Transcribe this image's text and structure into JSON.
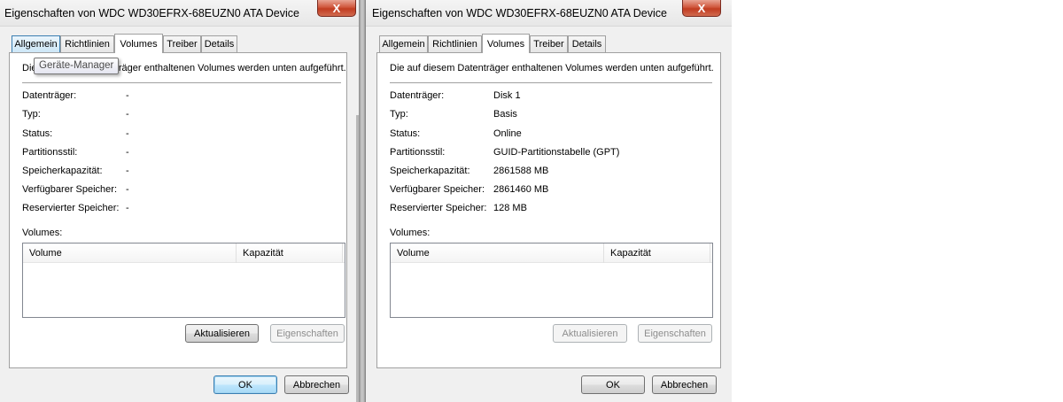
{
  "left": {
    "title": "Eigenschaften von WDC WD30EFRX-68EUZN0 ATA Device",
    "close_glyph": "X",
    "tabs": [
      {
        "label": "Allgemein"
      },
      {
        "label": "Richtlinien"
      },
      {
        "label": "Volumes"
      },
      {
        "label": "Treiber"
      },
      {
        "label": "Details"
      }
    ],
    "active_tab": "Volumes",
    "tooltip": "Geräte-Manager",
    "description": "Die auf diesem Datenträger enthaltenen Volumes werden unten aufgeführt.",
    "properties": [
      {
        "label": "Datenträger:",
        "value": "-"
      },
      {
        "label": "Typ:",
        "value": "-"
      },
      {
        "label": "Status:",
        "value": "-"
      },
      {
        "label": "Partitionsstil:",
        "value": "-"
      },
      {
        "label": "Speicherkapazität:",
        "value": "-"
      },
      {
        "label": "Verfügbarer Speicher:",
        "value": "-"
      },
      {
        "label": "Reservierter Speicher:",
        "value": "-"
      }
    ],
    "volumes_label": "Volumes:",
    "columns": [
      "Volume",
      "Kapazität"
    ],
    "buttons": {
      "refresh": "Aktualisieren",
      "properties": "Eigenschaften",
      "ok": "OK",
      "cancel": "Abbrechen"
    }
  },
  "right": {
    "title": "Eigenschaften von WDC WD30EFRX-68EUZN0 ATA Device",
    "close_glyph": "X",
    "tabs": [
      {
        "label": "Allgemein"
      },
      {
        "label": "Richtlinien"
      },
      {
        "label": "Volumes"
      },
      {
        "label": "Treiber"
      },
      {
        "label": "Details"
      }
    ],
    "active_tab": "Volumes",
    "description": "Die auf diesem Datenträger enthaltenen Volumes werden unten aufgeführt.",
    "properties": [
      {
        "label": "Datenträger:",
        "value": "Disk 1"
      },
      {
        "label": "Typ:",
        "value": "Basis"
      },
      {
        "label": "Status:",
        "value": "Online"
      },
      {
        "label": "Partitionsstil:",
        "value": "GUID-Partitionstabelle (GPT)"
      },
      {
        "label": "Speicherkapazität:",
        "value": "2861588 MB"
      },
      {
        "label": "Verfügbarer Speicher:",
        "value": "2861460 MB"
      },
      {
        "label": "Reservierter Speicher:",
        "value": "128 MB"
      }
    ],
    "volumes_label": "Volumes:",
    "columns": [
      "Volume",
      "Kapazität"
    ],
    "buttons": {
      "refresh": "Aktualisieren",
      "properties": "Eigenschaften",
      "ok": "OK",
      "cancel": "Abbrechen"
    }
  }
}
